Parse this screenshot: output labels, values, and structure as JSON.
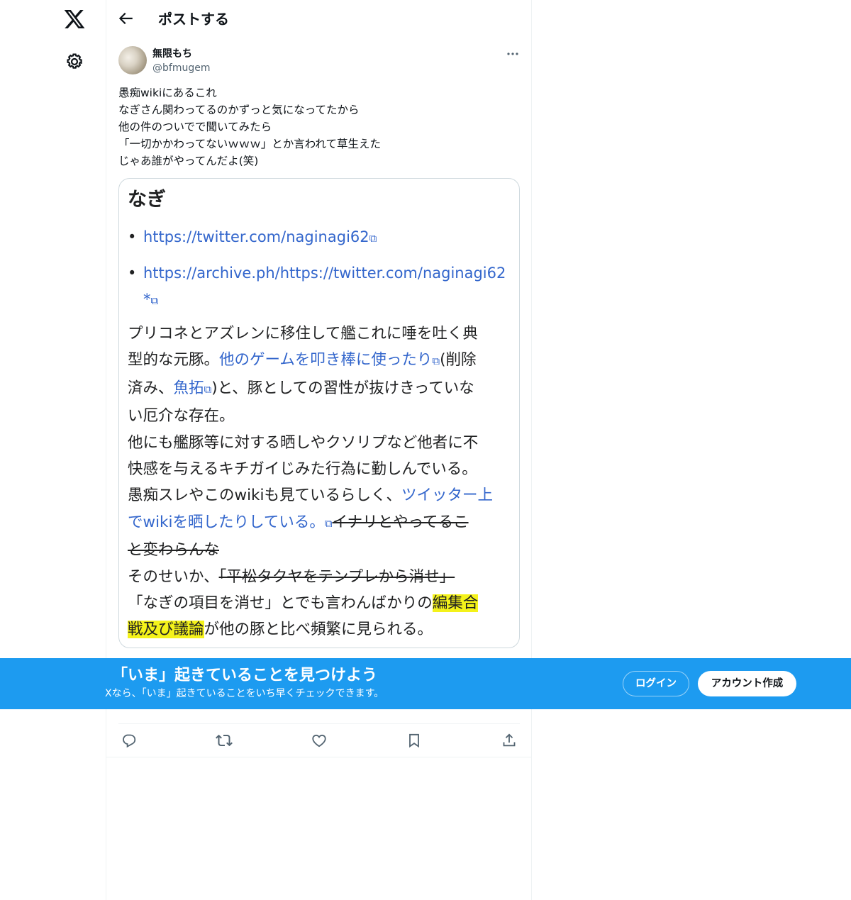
{
  "rail": {
    "logo_icon": "x-logo-icon",
    "settings_icon": "gear-icon"
  },
  "header": {
    "back_icon": "back-arrow-icon",
    "title": "ポストする"
  },
  "post": {
    "author": {
      "display_name": "無限もち",
      "handle": "@bfmugem"
    },
    "more_icon": "more-dots-icon",
    "text_lines": [
      "愚痴wikiにあるこれ",
      "なぎさん関わってるのかずっと気になってたから",
      "他の件のついでで聞いてみたら",
      "「一切かかわってないｗｗｗ」とか言われて草生えた",
      "じゃあ誰がやってんだよ(笑)"
    ],
    "media": {
      "heading": "なぎ",
      "links": [
        "https://twitter.com/naginagi62",
        "https://archive.ph/https://twitter.com/naginagi62",
        "*"
      ],
      "ext_glyph": "⧉",
      "body": {
        "l1": "プリコネとアズレンに移住して艦これに唾を吐く典",
        "l2a": "型的な元豚。",
        "l2link": "他のゲームを叩き棒に使ったり",
        "l2b": "(削除",
        "l3a": "済み、",
        "l3link": "魚拓",
        "l3b": ")と、豚としての習性が抜けきっていな",
        "l4": "い厄介な存在。",
        "l5": "他にも艦豚等に対する晒しやクソリプなど他者に不",
        "l6": "快感を与えるキチガイじみた行為に勤しんでいる。",
        "l7a": "愚痴スレやこのwikiも見ているらしく、",
        "l7link": "ツイッター上",
        "l8link": "でwikiを晒したりしている。",
        "l8strike": "イナリとやってるこ",
        "l9strike": "と変わらんな",
        "l10a": "そのせいか、",
        "l10strike": "「平松タクヤをテンプレから消せ」",
        "l11a": "「なぎの項目を消せ」とでも言わんばかりの",
        "l11hl": "編集合",
        "l12hl": "戦及び議論",
        "l12b": "が他の豚と比べ頻繁に見られる。"
      }
    },
    "actions": [
      "reply-icon",
      "repost-icon",
      "like-icon",
      "bookmark-icon",
      "share-icon"
    ]
  },
  "banner": {
    "title": "「いま」起きていることを見つけよう",
    "subtitle": "Xなら、「いま」起きていることをいち早くチェックできます。",
    "login_label": "ログイン",
    "signup_label": "アカウント作成",
    "bg_color": "#1d9bf0"
  }
}
